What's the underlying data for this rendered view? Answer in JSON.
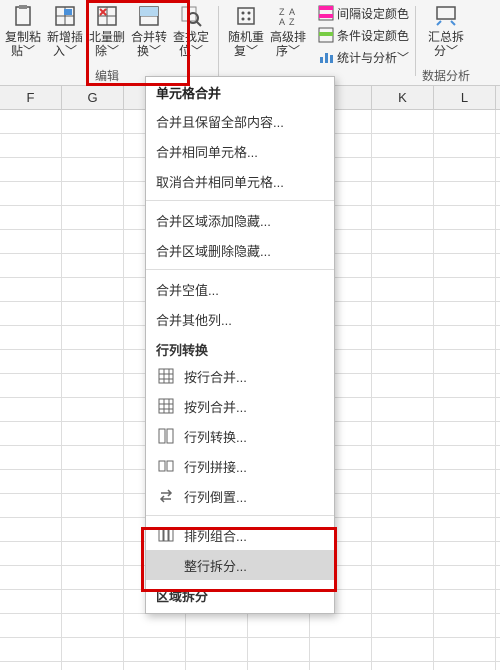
{
  "ribbon": {
    "group_edit": "编辑",
    "group_data": "数据分析",
    "copy_paste": "复制粘\n贴﹀",
    "insert": "新增插\n入﹀",
    "batch_delete": "北量删\n除﹀",
    "merge_convert": "合并转\n换﹀",
    "find_locate": "查找定\n位﹀",
    "random_redo": "随机重\n复﹀",
    "adv_sort": "高级排\n序﹀",
    "summary_split": "汇总拆\n分﹀",
    "side_interval_color": "间隔设定颜色",
    "side_cond_color": "条件设定颜色",
    "side_stats": "统计与分析﹀"
  },
  "columns": [
    "F",
    "G",
    "",
    "",
    "",
    "",
    "K",
    "L"
  ],
  "menu": {
    "h1": "单元格合并",
    "i1": "合并且保留全部内容...",
    "i2": "合并相同单元格...",
    "i3": "取消合并相同单元格...",
    "i4": "合并区域添加隐藏...",
    "i5": "合并区域删除隐藏...",
    "i6": "合并空值...",
    "i7": "合并其他列...",
    "h2": "行列转换",
    "r1": "按行合并...",
    "r2": "按列合并...",
    "r3": "行列转换...",
    "r4": "行列拼接...",
    "r5": "行列倒置...",
    "r6": "排列组合...",
    "r7": "整行拆分...",
    "h3": "区域拆分"
  }
}
